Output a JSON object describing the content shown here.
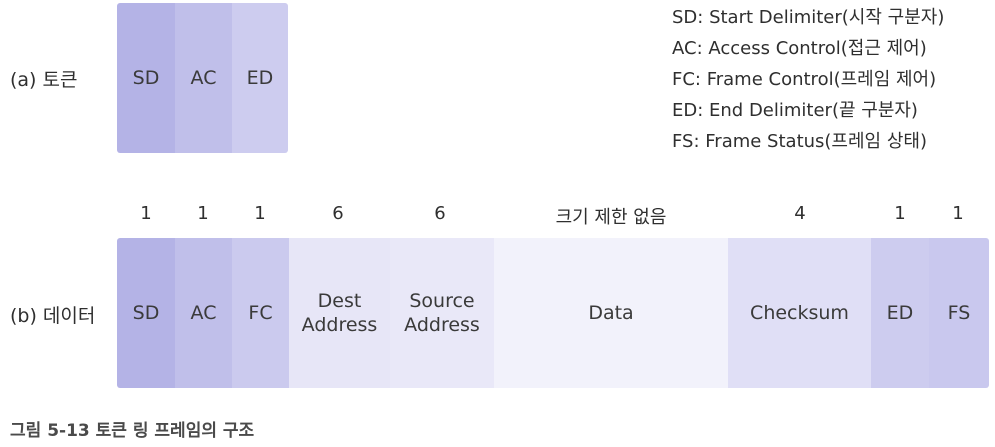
{
  "token": {
    "label": "(a) 토큰",
    "fields": [
      "SD",
      "AC",
      "ED"
    ]
  },
  "legend": [
    "SD: Start Delimiter(시작 구분자)",
    "AC: Access Control(접근 제어)",
    "FC: Frame Control(프레임 제어)",
    "ED: End Delimiter(끝 구분자)",
    "FS: Frame Status(프레임 상태)"
  ],
  "data_frame": {
    "label": "(b) 데이터",
    "sizes": [
      "1",
      "1",
      "1",
      "6",
      "6",
      "크기 제한 없음",
      "4",
      "1",
      "1"
    ],
    "fields": [
      {
        "line1": "SD",
        "line2": ""
      },
      {
        "line1": "AC",
        "line2": ""
      },
      {
        "line1": "FC",
        "line2": ""
      },
      {
        "line1": "Dest",
        "line2": "Address"
      },
      {
        "line1": "Source",
        "line2": "Address"
      },
      {
        "line1": "Data",
        "line2": ""
      },
      {
        "line1": "Checksum",
        "line2": ""
      },
      {
        "line1": "ED",
        "line2": ""
      },
      {
        "line1": "FS",
        "line2": ""
      }
    ]
  },
  "caption": "그림 5-13  토큰 링 프레임의 구조",
  "colors": {
    "sd": "#b4b3e6",
    "ac": "#c0bfea",
    "fc": "#cbcaee",
    "ed": "#cdccef",
    "fs": "#c9c8ee",
    "address": "#e7e6f7",
    "data": "#f2f2fb",
    "checksum": "#e0dff6"
  }
}
